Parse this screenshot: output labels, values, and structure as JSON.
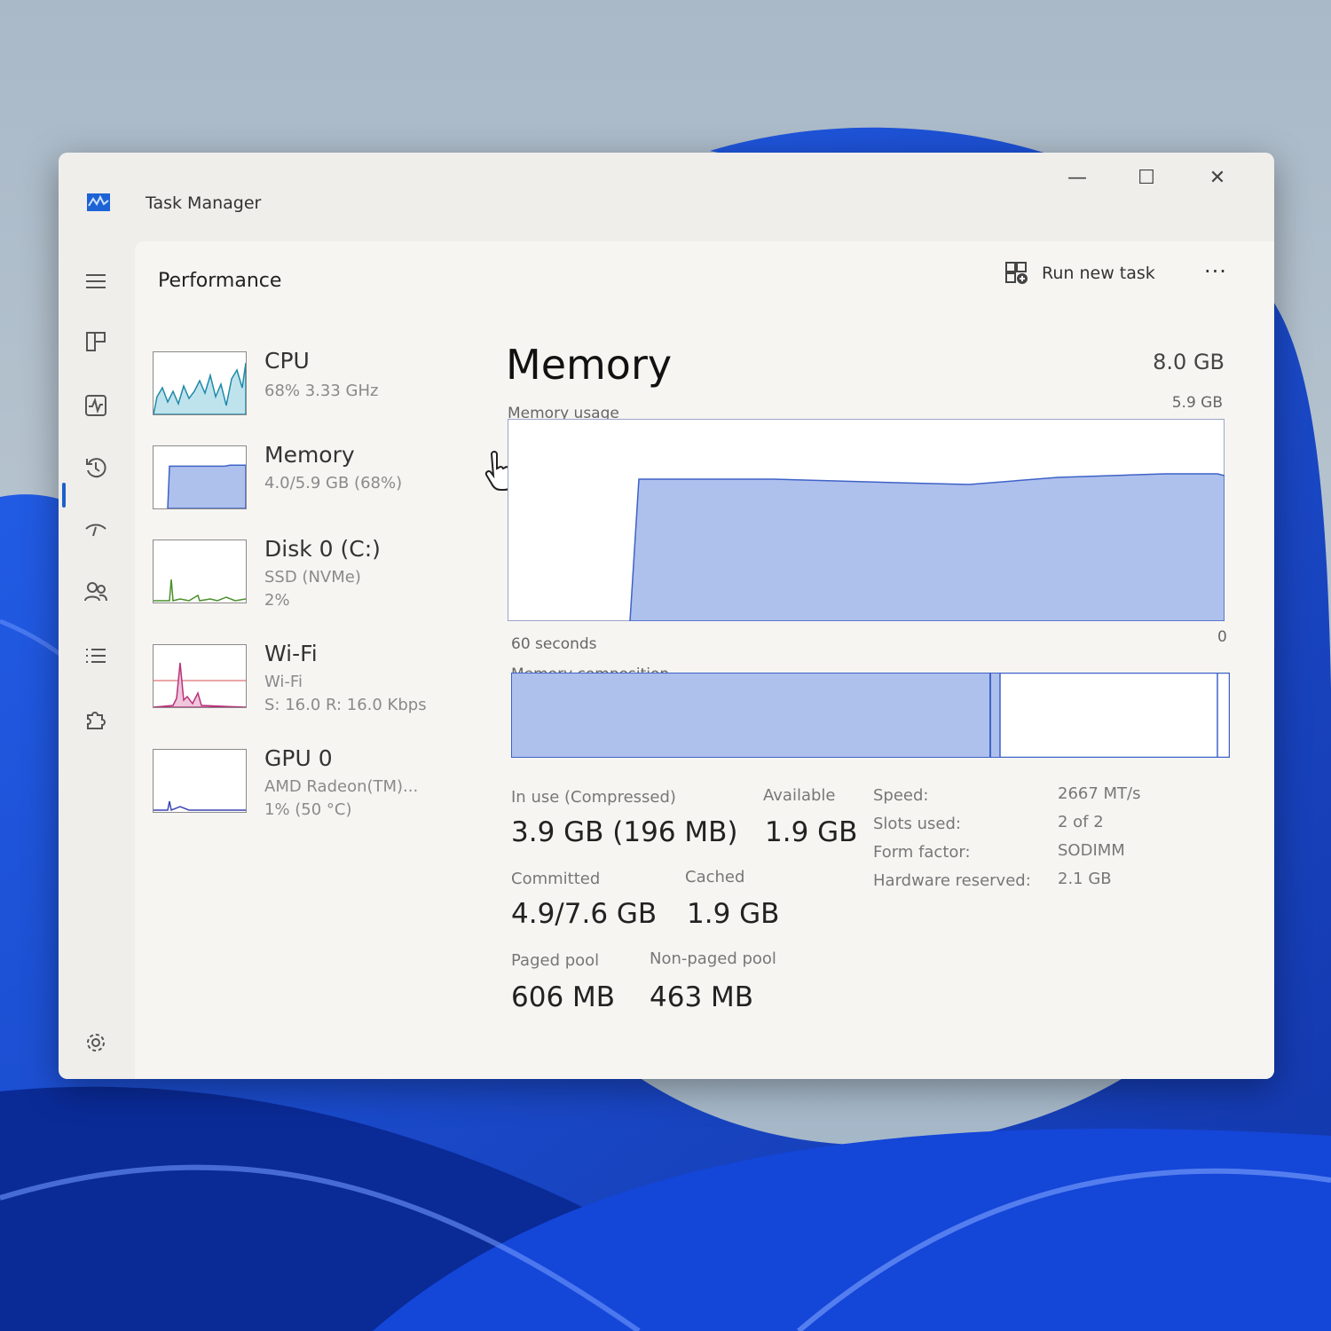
{
  "window": {
    "title": "Task Manager",
    "controls": {
      "minimize": "—",
      "maximize": "☐",
      "close": "✕"
    }
  },
  "nav": {
    "items": [
      {
        "name": "menu",
        "icon": "hamburger-icon"
      },
      {
        "name": "processes",
        "icon": "processes-icon"
      },
      {
        "name": "performance",
        "icon": "performance-icon",
        "selected": true
      },
      {
        "name": "app-history",
        "icon": "history-icon"
      },
      {
        "name": "startup-apps",
        "icon": "startup-icon"
      },
      {
        "name": "users",
        "icon": "users-icon"
      },
      {
        "name": "details",
        "icon": "details-list-icon"
      },
      {
        "name": "services",
        "icon": "services-puzzle-icon"
      },
      {
        "name": "settings",
        "icon": "gear-icon"
      }
    ]
  },
  "header": {
    "page_title": "Performance",
    "run_new_task": "Run new task",
    "more": "···"
  },
  "devices": [
    {
      "name": "CPU",
      "line1": "68% 3.33 GHz",
      "line2": "",
      "color": "#1e8aa8",
      "fill": "#bfe3ec"
    },
    {
      "name": "Memory",
      "line1": "4.0/5.9 GB (68%)",
      "line2": "",
      "color": "#3e63c8",
      "fill": "#aec0ec",
      "usage": 0.68
    },
    {
      "name": "Disk 0 (C:)",
      "line1": "SSD (NVMe)",
      "line2": "2%",
      "color": "#4a8f28",
      "fill": "#cde6c0"
    },
    {
      "name": "Wi-Fi",
      "line1": "Wi-Fi",
      "line2": "S: 16.0  R: 16.0 Kbps",
      "color": "#b8337a",
      "fill": "#efc6dc"
    },
    {
      "name": "GPU 0",
      "line1": "AMD Radeon(TM)...",
      "line2": "1% (50 °C)",
      "color": "#3b45b4",
      "fill": "#c6caef"
    }
  ],
  "memory": {
    "title": "Memory",
    "total": "8.0 GB",
    "usage_label": "Memory usage",
    "usage_max": "5.9 GB",
    "axis_left": "60 seconds",
    "axis_right": "0",
    "composition_label": "Memory composition",
    "accent": "#3e63c8",
    "fill": "#aec0ec",
    "stats": {
      "in_use_label": "In use (Compressed)",
      "in_use_value": "3.9 GB (196 MB)",
      "available_label": "Available",
      "available_value": "1.9 GB",
      "committed_label": "Committed",
      "committed_value": "4.9/7.6 GB",
      "cached_label": "Cached",
      "cached_value": "1.9 GB",
      "paged_label": "Paged pool",
      "paged_value": "606 MB",
      "nonpaged_label": "Non-paged pool",
      "nonpaged_value": "463 MB"
    },
    "specs": [
      {
        "label": "Speed:",
        "value": "2667 MT/s"
      },
      {
        "label": "Slots used:",
        "value": "2 of 2"
      },
      {
        "label": "Form factor:",
        "value": "SODIMM"
      },
      {
        "label": "Hardware reserved:",
        "value": "2.1 GB"
      }
    ]
  }
}
